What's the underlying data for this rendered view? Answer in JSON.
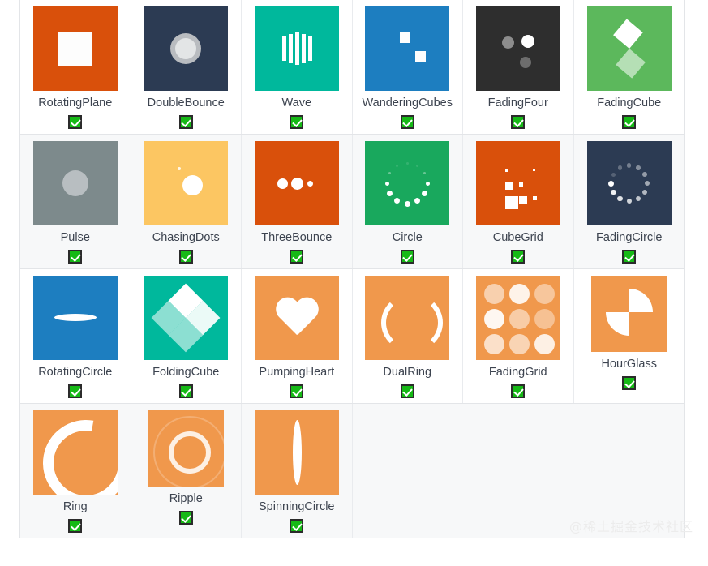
{
  "page": {
    "background": "#ffffff",
    "border_color": "#e3e5e8",
    "alt_row_background": "#f7f8f9",
    "label_color": "#3d4450",
    "checkbox_color": "#16b916"
  },
  "watermark": {
    "text": "@稀土掘金技术社区",
    "color": "#ececec"
  },
  "grid": {
    "columns": 6,
    "rows": [
      {
        "background": "#ffffff",
        "cells": [
          {
            "label": "RotatingPlane",
            "checked": true,
            "checkmark": "✓",
            "demo_bg": "#d9500b",
            "icon": "rotating-plane-spinner"
          },
          {
            "label": "DoubleBounce",
            "checked": true,
            "checkmark": "✓",
            "demo_bg": "#2c3b53",
            "icon": "double-bounce-spinner"
          },
          {
            "label": "Wave",
            "checked": true,
            "checkmark": "✓",
            "demo_bg": "#00b89c",
            "icon": "wave-spinner"
          },
          {
            "label": "WanderingCubes",
            "checked": true,
            "checkmark": "✓",
            "demo_bg": "#1d7ec0",
            "icon": "wandering-cubes-spinner"
          },
          {
            "label": "FadingFour",
            "checked": true,
            "checkmark": "✓",
            "demo_bg": "#2e2e2e",
            "icon": "fading-four-spinner"
          },
          {
            "label": "FadingCube",
            "checked": true,
            "checkmark": "✓",
            "demo_bg": "#5cb85c",
            "icon": "fading-cube-spinner"
          }
        ]
      },
      {
        "background": "#f7f8f9",
        "cells": [
          {
            "label": "Pulse",
            "checked": true,
            "checkmark": "✓",
            "demo_bg": "#7d8a8c",
            "icon": "pulse-spinner"
          },
          {
            "label": "ChasingDots",
            "checked": true,
            "checkmark": "✓",
            "demo_bg": "#fcc662",
            "icon": "chasing-dots-spinner"
          },
          {
            "label": "ThreeBounce",
            "checked": true,
            "checkmark": "✓",
            "demo_bg": "#d9500b",
            "icon": "three-bounce-spinner"
          },
          {
            "label": "Circle",
            "checked": true,
            "checkmark": "✓",
            "demo_bg": "#19a85d",
            "icon": "circle-spinner"
          },
          {
            "label": "CubeGrid",
            "checked": true,
            "checkmark": "✓",
            "demo_bg": "#d9500b",
            "icon": "cube-grid-spinner"
          },
          {
            "label": "FadingCircle",
            "checked": true,
            "checkmark": "✓",
            "demo_bg": "#2c3b53",
            "icon": "fading-circle-spinner"
          }
        ]
      },
      {
        "background": "#ffffff",
        "cells": [
          {
            "label": "RotatingCircle",
            "checked": true,
            "checkmark": "✓",
            "demo_bg": "#1d7ec0",
            "icon": "rotating-circle-spinner"
          },
          {
            "label": "FoldingCube",
            "checked": true,
            "checkmark": "✓",
            "demo_bg": "#00b89c",
            "icon": "folding-cube-spinner"
          },
          {
            "label": "PumpingHeart",
            "checked": true,
            "checkmark": "✓",
            "demo_bg": "#f0984c",
            "icon": "pumping-heart-spinner"
          },
          {
            "label": "DualRing",
            "checked": true,
            "checkmark": "✓",
            "demo_bg": "#f0984c",
            "icon": "dual-ring-spinner"
          },
          {
            "label": "FadingGrid",
            "checked": true,
            "checkmark": "✓",
            "demo_bg": "#f0984c",
            "icon": "fading-grid-spinner"
          },
          {
            "label": "HourGlass",
            "checked": true,
            "checkmark": "✓",
            "demo_bg": "#f0984c",
            "icon": "hour-glass-spinner"
          }
        ]
      },
      {
        "background": "#f7f8f9",
        "cells": [
          {
            "label": "Ring",
            "checked": true,
            "checkmark": "✓",
            "demo_bg": "#f0984c",
            "icon": "ring-spinner"
          },
          {
            "label": "Ripple",
            "checked": true,
            "checkmark": "✓",
            "demo_bg": "#f0984c",
            "icon": "ripple-spinner"
          },
          {
            "label": "SpinningCircle",
            "checked": true,
            "checkmark": "✓",
            "demo_bg": "#f0984c",
            "icon": "spinning-circle-spinner"
          },
          {
            "label": "",
            "checked": false,
            "checkmark": "",
            "demo_bg": "",
            "icon": ""
          },
          {
            "label": "",
            "checked": false,
            "checkmark": "",
            "demo_bg": "",
            "icon": ""
          },
          {
            "label": "",
            "checked": false,
            "checkmark": "",
            "demo_bg": "",
            "icon": ""
          }
        ]
      }
    ]
  }
}
